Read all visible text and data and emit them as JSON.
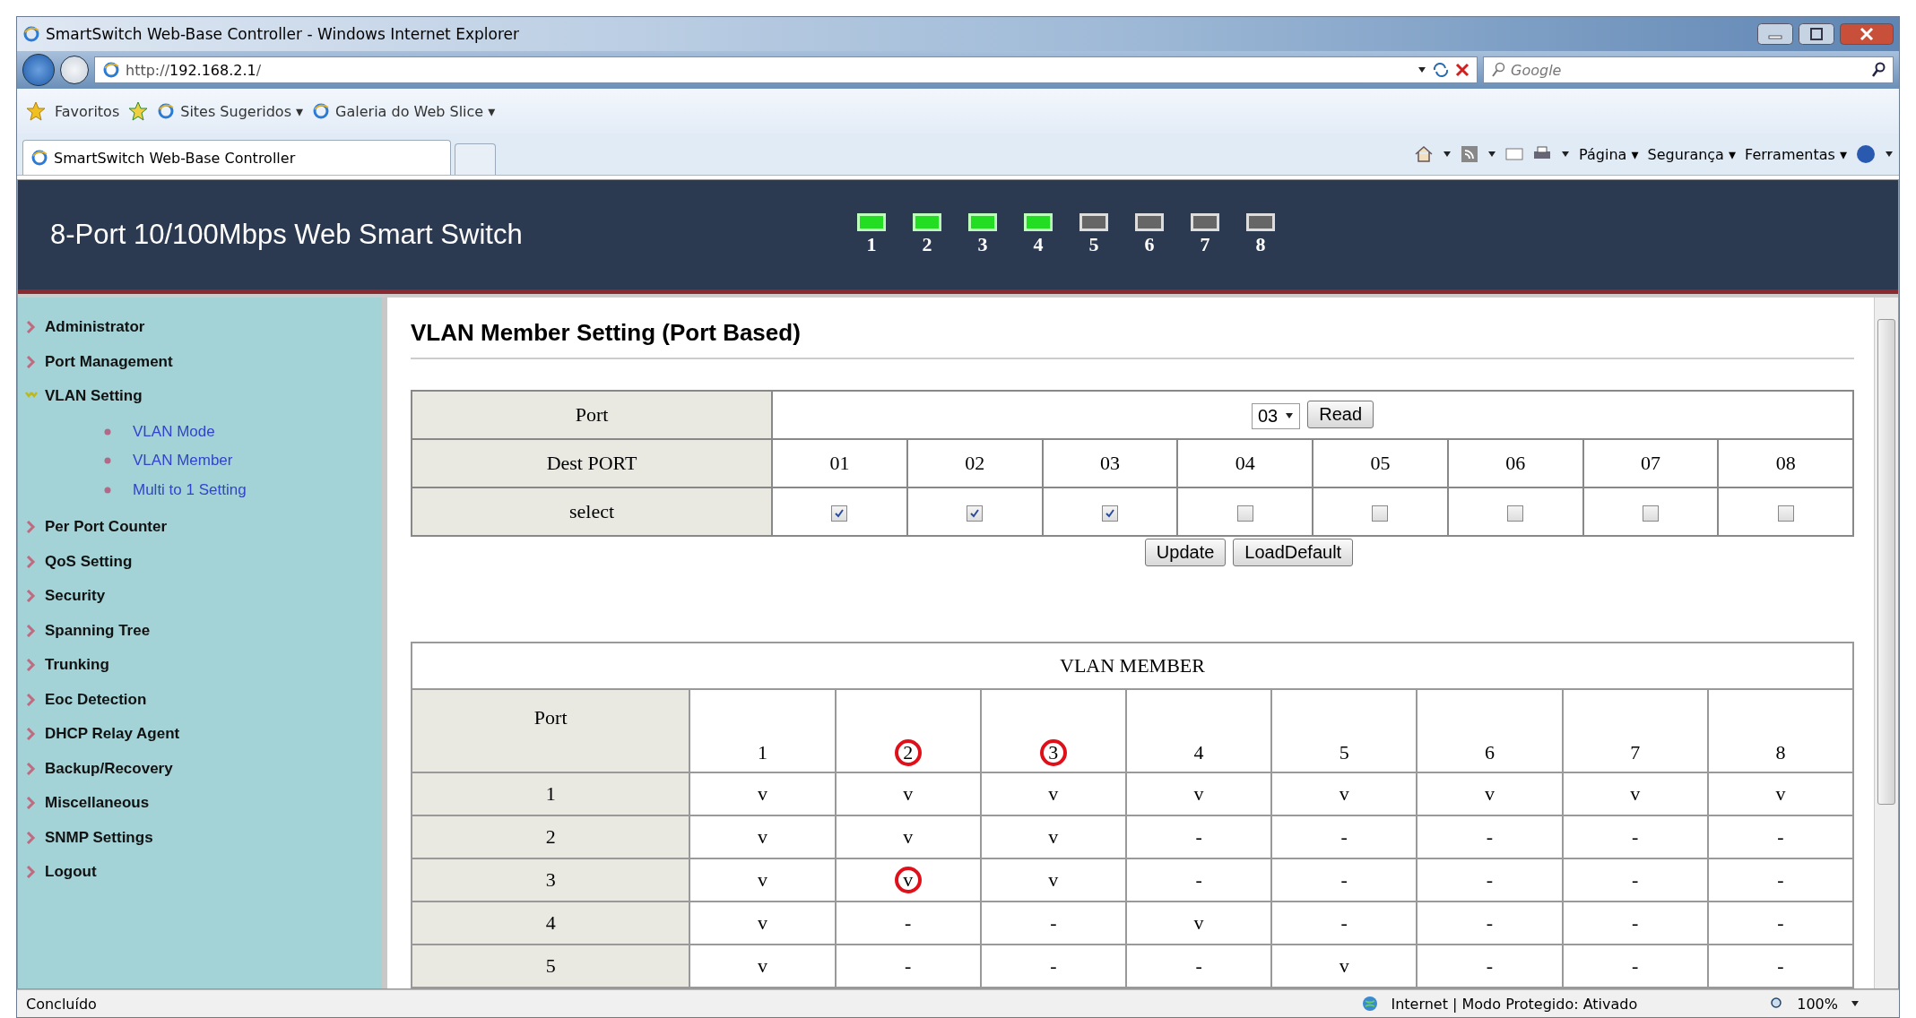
{
  "window": {
    "title": "SmartSwitch Web-Base Controller - Windows Internet Explorer"
  },
  "address_bar": {
    "url_prefix": "http://",
    "url_host": "192.168.2.1",
    "url_suffix": "/"
  },
  "search": {
    "placeholder": "Google"
  },
  "favorites_bar": {
    "favorites": "Favoritos",
    "items": [
      "Sites Sugeridos ▾",
      "Galeria do Web Slice ▾"
    ]
  },
  "tabs": [
    {
      "label": "SmartSwitch Web-Base Controller",
      "selected": true
    }
  ],
  "command_bar": [
    "Página ▾",
    "Segurança ▾",
    "Ferramentas ▾"
  ],
  "header": {
    "title": "8-Port 10/100Mbps Web Smart Switch",
    "ports": [
      {
        "label": "1",
        "on": true
      },
      {
        "label": "2",
        "on": true
      },
      {
        "label": "3",
        "on": true
      },
      {
        "label": "4",
        "on": true
      },
      {
        "label": "5",
        "on": false
      },
      {
        "label": "6",
        "on": false
      },
      {
        "label": "7",
        "on": false
      },
      {
        "label": "8",
        "on": false
      }
    ]
  },
  "sidebar": {
    "items": [
      {
        "label": "Administrator",
        "expanded": false
      },
      {
        "label": "Port Management",
        "expanded": false
      },
      {
        "label": "VLAN Setting",
        "expanded": true,
        "children": [
          {
            "label": "VLAN Mode"
          },
          {
            "label": "VLAN Member"
          },
          {
            "label": "Multi to 1 Setting"
          }
        ]
      },
      {
        "label": "Per Port Counter",
        "expanded": false
      },
      {
        "label": "QoS Setting",
        "expanded": false
      },
      {
        "label": "Security",
        "expanded": false
      },
      {
        "label": "Spanning Tree",
        "expanded": false
      },
      {
        "label": "Trunking",
        "expanded": false
      },
      {
        "label": "Eoc Detection",
        "expanded": false
      },
      {
        "label": "DHCP Relay Agent",
        "expanded": false
      },
      {
        "label": "Backup/Recovery",
        "expanded": false
      },
      {
        "label": "Miscellaneous",
        "expanded": false
      },
      {
        "label": "SNMP Settings",
        "expanded": false
      },
      {
        "label": "Logout",
        "expanded": false
      }
    ]
  },
  "content": {
    "heading": "VLAN Member Setting (Port Based)",
    "setting_table": {
      "port_label": "Port",
      "port_value": "03",
      "read_button": "Read",
      "dest_label": "Dest PORT",
      "select_label": "select",
      "dest_ports": [
        {
          "label": "01",
          "checked": true
        },
        {
          "label": "02",
          "checked": true
        },
        {
          "label": "03",
          "checked": true
        },
        {
          "label": "04",
          "checked": false
        },
        {
          "label": "05",
          "checked": false
        },
        {
          "label": "06",
          "checked": false
        },
        {
          "label": "07",
          "checked": false
        },
        {
          "label": "08",
          "checked": false
        }
      ]
    },
    "buttons": [
      "Update",
      "LoadDefault"
    ],
    "member_table": {
      "title": "VLAN MEMBER",
      "corner": "Port",
      "columns": [
        {
          "label": "1",
          "circled": false
        },
        {
          "label": "2",
          "circled": true
        },
        {
          "label": "3",
          "circled": true
        },
        {
          "label": "4",
          "circled": false
        },
        {
          "label": "5",
          "circled": false
        },
        {
          "label": "6",
          "circled": false
        },
        {
          "label": "7",
          "circled": false
        },
        {
          "label": "8",
          "circled": false
        }
      ],
      "rows": [
        {
          "port": "1",
          "cells": [
            {
              "text": "v",
              "circled": false
            },
            {
              "text": "v",
              "circled": false
            },
            {
              "text": "v",
              "circled": false
            },
            {
              "text": "v",
              "circled": false
            },
            {
              "text": "v",
              "circled": false
            },
            {
              "text": "v",
              "circled": false
            },
            {
              "text": "v",
              "circled": false
            },
            {
              "text": "v",
              "circled": false
            }
          ]
        },
        {
          "port": "2",
          "cells": [
            {
              "text": "v",
              "circled": false
            },
            {
              "text": "v",
              "circled": false
            },
            {
              "text": "v",
              "circled": false
            },
            {
              "text": "-",
              "circled": false
            },
            {
              "text": "-",
              "circled": false
            },
            {
              "text": "-",
              "circled": false
            },
            {
              "text": "-",
              "circled": false
            },
            {
              "text": "-",
              "circled": false
            }
          ]
        },
        {
          "port": "3",
          "cells": [
            {
              "text": "v",
              "circled": false
            },
            {
              "text": "v",
              "circled": true
            },
            {
              "text": "v",
              "circled": false
            },
            {
              "text": "-",
              "circled": false
            },
            {
              "text": "-",
              "circled": false
            },
            {
              "text": "-",
              "circled": false
            },
            {
              "text": "-",
              "circled": false
            },
            {
              "text": "-",
              "circled": false
            }
          ]
        },
        {
          "port": "4",
          "cells": [
            {
              "text": "v",
              "circled": false
            },
            {
              "text": "-",
              "circled": false
            },
            {
              "text": "-",
              "circled": false
            },
            {
              "text": "v",
              "circled": false
            },
            {
              "text": "-",
              "circled": false
            },
            {
              "text": "-",
              "circled": false
            },
            {
              "text": "-",
              "circled": false
            },
            {
              "text": "-",
              "circled": false
            }
          ]
        },
        {
          "port": "5",
          "cells": [
            {
              "text": "v",
              "circled": false
            },
            {
              "text": "-",
              "circled": false
            },
            {
              "text": "-",
              "circled": false
            },
            {
              "text": "-",
              "circled": false
            },
            {
              "text": "v",
              "circled": false
            },
            {
              "text": "-",
              "circled": false
            },
            {
              "text": "-",
              "circled": false
            },
            {
              "text": "-",
              "circled": false
            }
          ]
        }
      ]
    }
  },
  "status_bar": {
    "status": "Concluído",
    "zone": "Internet | Modo Protegido: Ativado",
    "zoom": "100%"
  }
}
